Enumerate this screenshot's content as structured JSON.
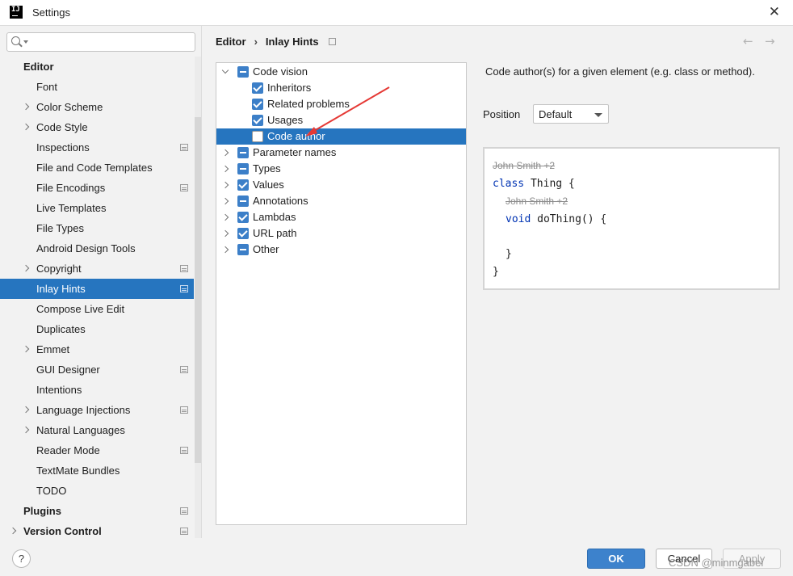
{
  "window": {
    "title": "Settings",
    "icon": "intellij-logo-icon",
    "icon_text": "IJ"
  },
  "search": {
    "placeholder": "",
    "icon": "search-icon"
  },
  "sidebar": {
    "items": [
      {
        "label": "Editor",
        "level": 0,
        "section": true,
        "chevron": false,
        "page_icon": false,
        "selected": false
      },
      {
        "label": "Font",
        "level": 1,
        "chevron": false,
        "page_icon": false,
        "selected": false
      },
      {
        "label": "Color Scheme",
        "level": 1,
        "chevron": true,
        "page_icon": false,
        "selected": false
      },
      {
        "label": "Code Style",
        "level": 1,
        "chevron": true,
        "page_icon": false,
        "selected": false
      },
      {
        "label": "Inspections",
        "level": 1,
        "chevron": false,
        "page_icon": true,
        "selected": false
      },
      {
        "label": "File and Code Templates",
        "level": 1,
        "chevron": false,
        "page_icon": false,
        "selected": false
      },
      {
        "label": "File Encodings",
        "level": 1,
        "chevron": false,
        "page_icon": true,
        "selected": false
      },
      {
        "label": "Live Templates",
        "level": 1,
        "chevron": false,
        "page_icon": false,
        "selected": false
      },
      {
        "label": "File Types",
        "level": 1,
        "chevron": false,
        "page_icon": false,
        "selected": false
      },
      {
        "label": "Android Design Tools",
        "level": 1,
        "chevron": false,
        "page_icon": false,
        "selected": false
      },
      {
        "label": "Copyright",
        "level": 1,
        "chevron": true,
        "page_icon": true,
        "selected": false
      },
      {
        "label": "Inlay Hints",
        "level": 1,
        "chevron": false,
        "page_icon": true,
        "selected": true
      },
      {
        "label": "Compose Live Edit",
        "level": 1,
        "chevron": false,
        "page_icon": false,
        "selected": false
      },
      {
        "label": "Duplicates",
        "level": 1,
        "chevron": false,
        "page_icon": false,
        "selected": false
      },
      {
        "label": "Emmet",
        "level": 1,
        "chevron": true,
        "page_icon": false,
        "selected": false
      },
      {
        "label": "GUI Designer",
        "level": 1,
        "chevron": false,
        "page_icon": true,
        "selected": false
      },
      {
        "label": "Intentions",
        "level": 1,
        "chevron": false,
        "page_icon": false,
        "selected": false
      },
      {
        "label": "Language Injections",
        "level": 1,
        "chevron": true,
        "page_icon": true,
        "selected": false
      },
      {
        "label": "Natural Languages",
        "level": 1,
        "chevron": true,
        "page_icon": false,
        "selected": false
      },
      {
        "label": "Reader Mode",
        "level": 1,
        "chevron": false,
        "page_icon": true,
        "selected": false
      },
      {
        "label": "TextMate Bundles",
        "level": 1,
        "chevron": false,
        "page_icon": false,
        "selected": false
      },
      {
        "label": "TODO",
        "level": 1,
        "chevron": false,
        "page_icon": false,
        "selected": false
      },
      {
        "label": "Plugins",
        "level": 0,
        "section": true,
        "chevron": false,
        "page_icon": true,
        "selected": false
      },
      {
        "label": "Version Control",
        "level": 0,
        "section": true,
        "chevron": true,
        "page_icon": true,
        "selected": false
      }
    ]
  },
  "breadcrumb": {
    "parent": "Editor",
    "separator": "›",
    "current": "Inlay Hints",
    "back_icon": "←",
    "forward_icon": "→"
  },
  "tree": {
    "items": [
      {
        "label": "Code vision",
        "level": 0,
        "expander": "open",
        "check": "partial",
        "selected": false
      },
      {
        "label": "Inheritors",
        "level": 1,
        "expander": "none",
        "check": "checked",
        "selected": false
      },
      {
        "label": "Related problems",
        "level": 1,
        "expander": "none",
        "check": "checked",
        "selected": false
      },
      {
        "label": "Usages",
        "level": 1,
        "expander": "none",
        "check": "checked",
        "selected": false
      },
      {
        "label": "Code author",
        "level": 1,
        "expander": "none",
        "check": "empty",
        "selected": true
      },
      {
        "label": "Parameter names",
        "level": 0,
        "expander": "closed",
        "check": "partial",
        "selected": false
      },
      {
        "label": "Types",
        "level": 0,
        "expander": "closed",
        "check": "partial",
        "selected": false
      },
      {
        "label": "Values",
        "level": 0,
        "expander": "closed",
        "check": "checked",
        "selected": false
      },
      {
        "label": "Annotations",
        "level": 0,
        "expander": "closed",
        "check": "partial",
        "selected": false
      },
      {
        "label": "Lambdas",
        "level": 0,
        "expander": "closed",
        "check": "checked",
        "selected": false
      },
      {
        "label": "URL path",
        "level": 0,
        "expander": "closed",
        "check": "checked",
        "selected": false
      },
      {
        "label": "Other",
        "level": 0,
        "expander": "closed",
        "check": "partial",
        "selected": false
      }
    ]
  },
  "details": {
    "description": "Code author(s) for a given element (e.g. class or method).",
    "position_label": "Position",
    "position_value": "Default"
  },
  "preview": {
    "hint1": "John Smith +2",
    "class_kw": "class",
    "class_rest": " Thing {",
    "hint2": "John Smith +2",
    "method_kw": "void",
    "method_rest": " doThing() {",
    "close_inner": "}",
    "close_outer": "}"
  },
  "buttons": {
    "help": "?",
    "ok": "OK",
    "cancel": "Cancel",
    "apply": "Apply"
  },
  "watermark": "CSDN @minmgabei",
  "colors": {
    "selection": "#2675bf",
    "checkbox": "#3c7fc8",
    "keyword": "#0033b3",
    "annotation_arrow": "#e53935"
  }
}
